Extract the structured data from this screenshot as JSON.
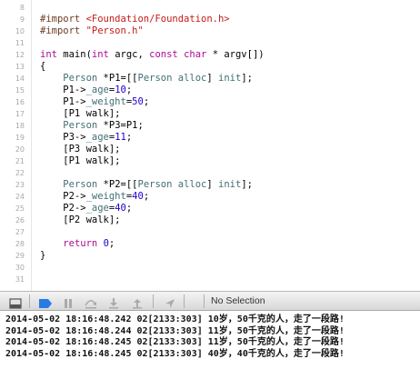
{
  "editor": {
    "lines": [
      {
        "n": "8",
        "code": ""
      },
      {
        "n": "9",
        "code": "#import <Foundation/Foundation.h>"
      },
      {
        "n": "10",
        "code": "#import \"Person.h\""
      },
      {
        "n": "11",
        "code": ""
      },
      {
        "n": "12",
        "code": "int main(int argc, const char * argv[])"
      },
      {
        "n": "13",
        "code": "{"
      },
      {
        "n": "14",
        "code": "    Person *P1=[[Person alloc] init];"
      },
      {
        "n": "15",
        "code": "    P1->_age=10;"
      },
      {
        "n": "16",
        "code": "    P1->_weight=50;"
      },
      {
        "n": "17",
        "code": "    [P1 walk];"
      },
      {
        "n": "18",
        "code": "    Person *P3=P1;"
      },
      {
        "n": "19",
        "code": "    P3->_age=11;"
      },
      {
        "n": "20",
        "code": "    [P3 walk];"
      },
      {
        "n": "21",
        "code": "    [P1 walk];"
      },
      {
        "n": "22",
        "code": ""
      },
      {
        "n": "23",
        "code": "    Person *P2=[[Person alloc] init];"
      },
      {
        "n": "24",
        "code": "    P2->_weight=40;"
      },
      {
        "n": "25",
        "code": "    P2->_age=40;"
      },
      {
        "n": "26",
        "code": "    [P2 walk];"
      },
      {
        "n": "27",
        "code": ""
      },
      {
        "n": "28",
        "code": "    return 0;"
      },
      {
        "n": "29",
        "code": "}"
      },
      {
        "n": "30",
        "code": ""
      },
      {
        "n": "31",
        "code": ""
      }
    ]
  },
  "debug_bar": {
    "icons": [
      "hide-debug-area-icon",
      "breakpoint-toggle-icon",
      "pause-icon",
      "step-over-icon",
      "step-in-icon",
      "step-out-icon",
      "location-icon"
    ],
    "status": "No Selection"
  },
  "console": {
    "lines": [
      "2014-05-02 18:16:48.242 02[2133:303] 10岁，50千克的人，走了一段路!",
      "2014-05-02 18:16:48.244 02[2133:303] 11岁，50千克的人，走了一段路!",
      "2014-05-02 18:16:48.245 02[2133:303] 11岁，50千克的人，走了一段路!",
      "2014-05-02 18:16:48.245 02[2133:303] 40岁，40千克的人，走了一段路!"
    ]
  },
  "colors": {
    "keyword": "#aa0d91",
    "string": "#c41a16",
    "number": "#1c00cf",
    "type": "#3f6e74",
    "preprocessor": "#6d3b22",
    "breakpoint_button": "#2a7ae4"
  }
}
